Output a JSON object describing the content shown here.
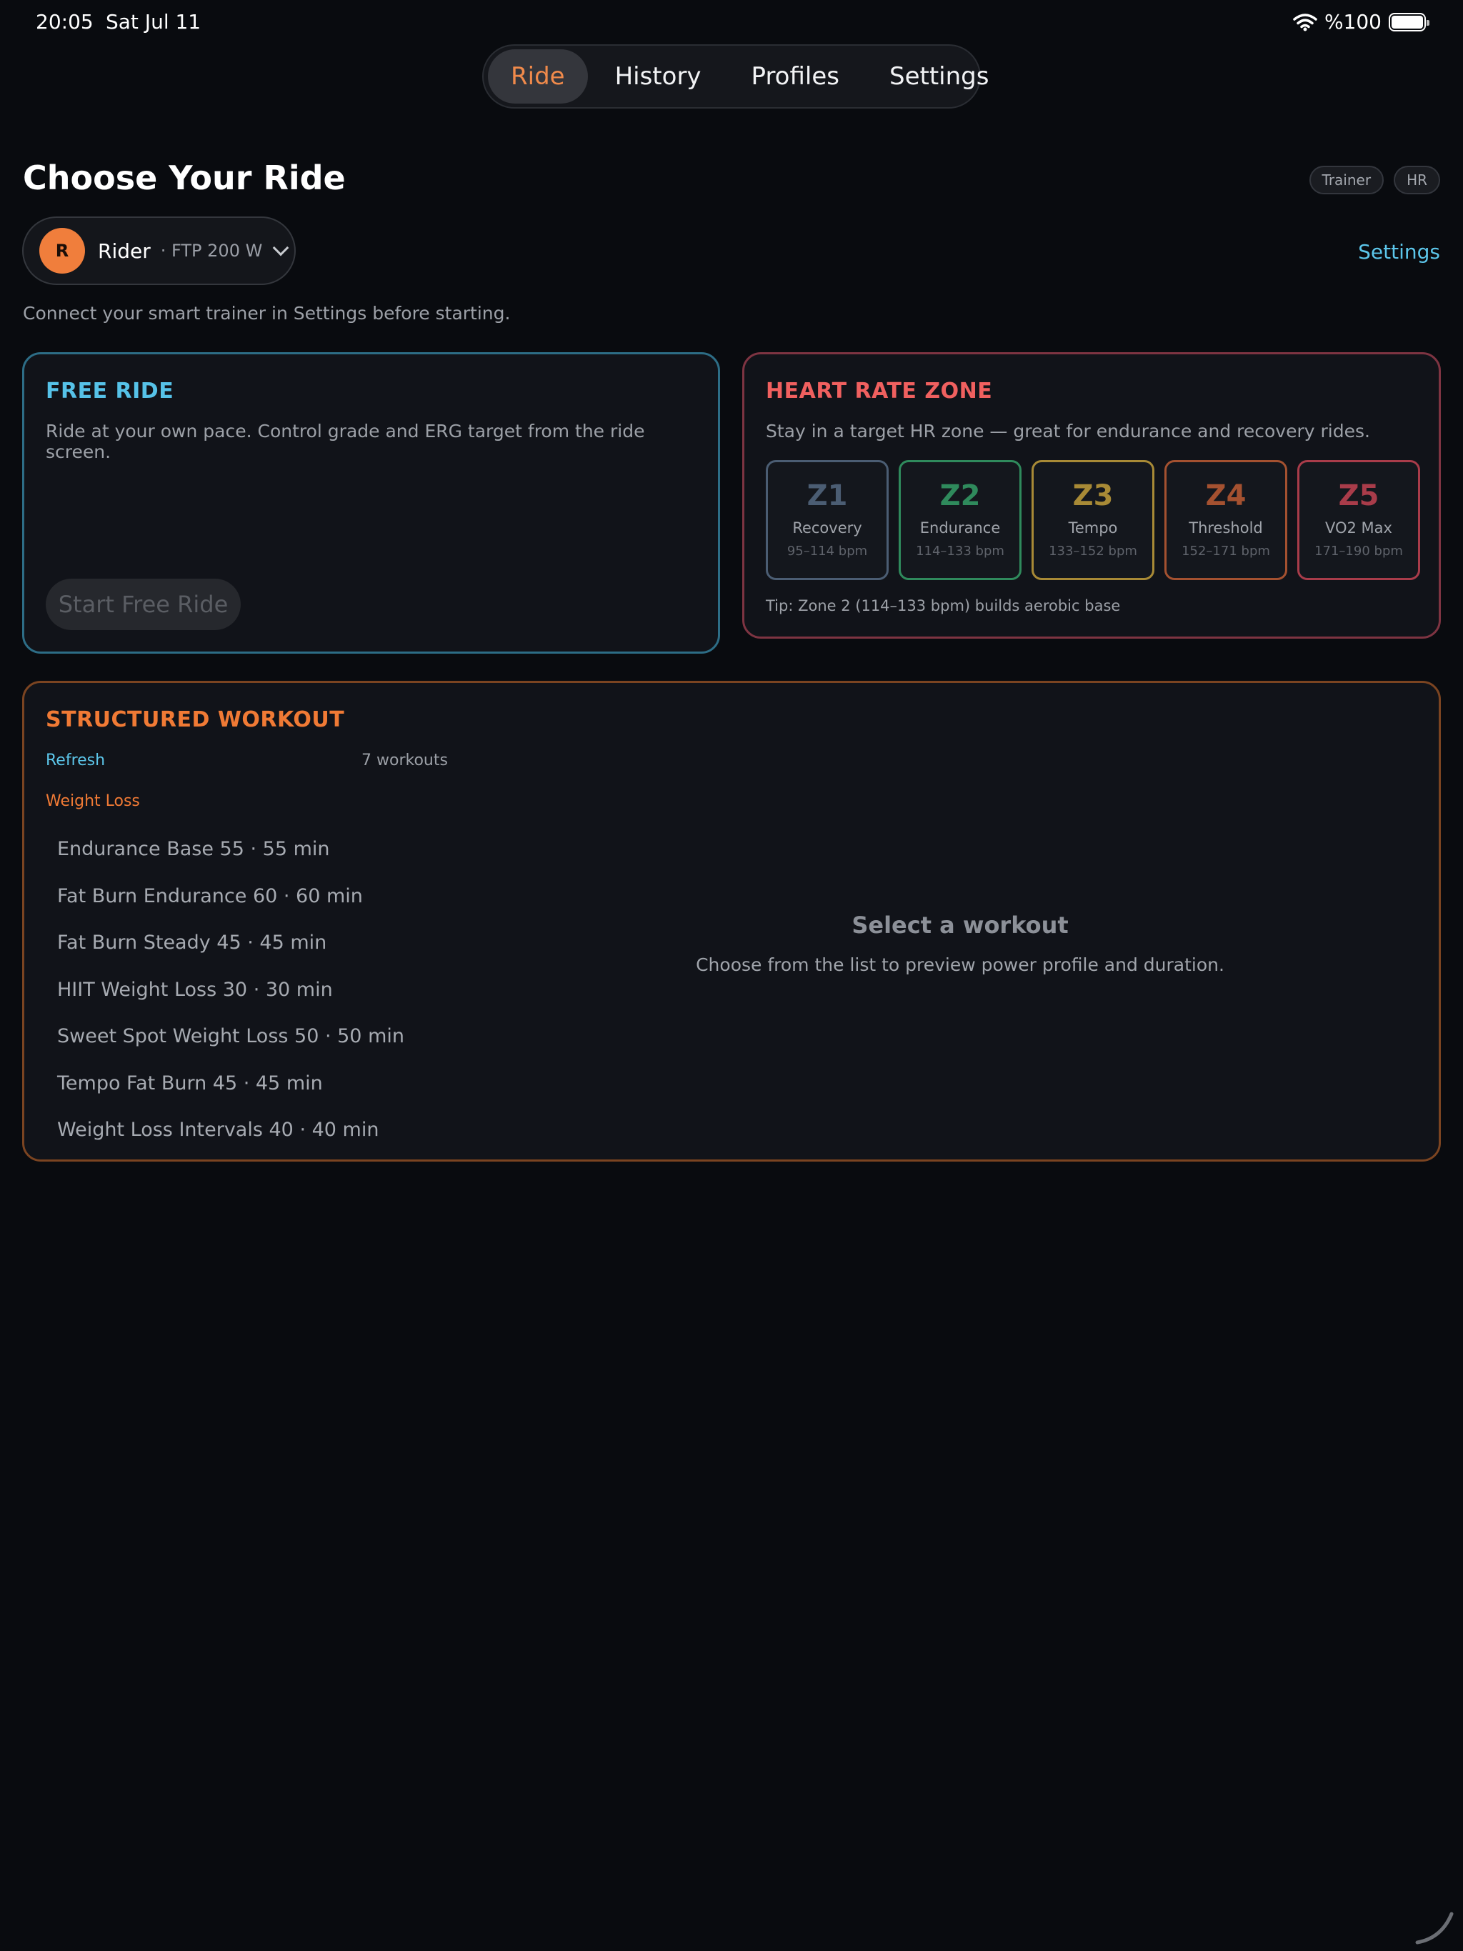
{
  "status_bar": {
    "time": "20:05",
    "date": "Sat Jul 11",
    "battery_text": "%100"
  },
  "tabs": [
    {
      "label": "Ride",
      "active": true
    },
    {
      "label": "History",
      "active": false
    },
    {
      "label": "Profiles",
      "active": false
    },
    {
      "label": "Settings",
      "active": false
    }
  ],
  "header": {
    "title": "Choose Your Ride",
    "pills": [
      "Trainer",
      "HR"
    ],
    "settings_link": "Settings",
    "hint": "Connect your smart trainer in Settings before starting."
  },
  "rider": {
    "initial": "R",
    "name": "Rider",
    "ftp": "· FTP 200 W"
  },
  "free_ride": {
    "title": "FREE RIDE",
    "description": "Ride at your own pace. Control grade and ERG target from the ride screen.",
    "button": "Start Free Ride"
  },
  "hr_zone": {
    "title": "HEART RATE ZONE",
    "description": "Stay in a target HR zone — great for endurance and recovery rides.",
    "zones": [
      {
        "code": "Z1",
        "name": "Recovery",
        "range": "95–114 bpm",
        "color": "#4b5d73"
      },
      {
        "code": "Z2",
        "name": "Endurance",
        "range": "114–133 bpm",
        "color": "#2f8a5c"
      },
      {
        "code": "Z3",
        "name": "Tempo",
        "range": "133–152 bpm",
        "color": "#a88a36"
      },
      {
        "code": "Z4",
        "name": "Threshold",
        "range": "152–171 bpm",
        "color": "#a45130"
      },
      {
        "code": "Z5",
        "name": "VO2 Max",
        "range": "171–190 bpm",
        "color": "#a93c4a"
      }
    ],
    "tip": "Tip: Zone 2 (114–133 bpm) builds aerobic base"
  },
  "structured": {
    "title": "STRUCTURED WORKOUT",
    "refresh": "Refresh",
    "count": "7 workouts",
    "category": "Weight Loss",
    "workouts": [
      "Endurance Base 55 · 55 min",
      "Fat Burn Endurance 60 · 60 min",
      "Fat Burn Steady 45 · 45 min",
      "HIIT Weight Loss 30 · 30 min",
      "Sweet Spot Weight Loss 50 · 50 min",
      "Tempo Fat Burn 45 · 45 min",
      "Weight Loss Intervals 40 · 40 min"
    ],
    "preview_title": "Select a workout",
    "preview_subtitle": "Choose from the list to preview power profile and duration."
  }
}
